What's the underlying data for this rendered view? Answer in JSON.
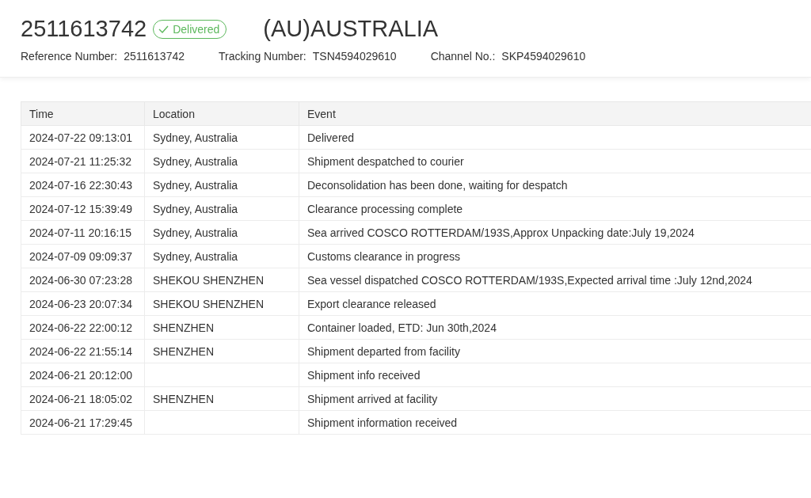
{
  "header": {
    "order_number": "2511613742",
    "status": {
      "label": "Delivered",
      "kind": "delivered"
    },
    "destination": "(AU)AUSTRALIA",
    "fields": [
      {
        "label": "Reference Number:",
        "value": "2511613742"
      },
      {
        "label": "Tracking Number:",
        "value": "TSN4594029610"
      },
      {
        "label": "Channel No.:",
        "value": "SKP4594029610"
      }
    ]
  },
  "table": {
    "columns": [
      "Time",
      "Location",
      "Event"
    ],
    "rows": [
      {
        "time": "2024-07-22 09:13:01",
        "location": "Sydney, Australia",
        "event": "Delivered"
      },
      {
        "time": "2024-07-21 11:25:32",
        "location": "Sydney, Australia",
        "event": "Shipment despatched to courier"
      },
      {
        "time": "2024-07-16 22:30:43",
        "location": "Sydney, Australia",
        "event": "Deconsolidation has been done, waiting for despatch"
      },
      {
        "time": "2024-07-12 15:39:49",
        "location": "Sydney, Australia",
        "event": "Clearance processing complete"
      },
      {
        "time": "2024-07-11 20:16:15",
        "location": "Sydney, Australia",
        "event": "Sea arrived COSCO ROTTERDAM/193S,Approx Unpacking date:July 19,2024"
      },
      {
        "time": "2024-07-09 09:09:37",
        "location": "Sydney, Australia",
        "event": "Customs clearance in progress"
      },
      {
        "time": "2024-06-30 07:23:28",
        "location": "SHEKOU SHENZHEN",
        "event": "Sea vessel dispatched COSCO ROTTERDAM/193S,Expected arrival time :July 12nd,2024"
      },
      {
        "time": "2024-06-23 20:07:34",
        "location": "SHEKOU SHENZHEN",
        "event": "Export clearance released"
      },
      {
        "time": "2024-06-22 22:00:12",
        "location": "SHENZHEN",
        "event": "Container loaded, ETD: Jun 30th,2024"
      },
      {
        "time": "2024-06-22 21:55:14",
        "location": "SHENZHEN",
        "event": "Shipment departed from facility"
      },
      {
        "time": "2024-06-21 20:12:00",
        "event": "Shipment info received"
      },
      {
        "time": "2024-06-21 18:05:02",
        "location": "SHENZHEN",
        "event": "Shipment arrived at facility"
      },
      {
        "time": "2024-06-21 17:29:45",
        "event": "Shipment information received"
      }
    ]
  }
}
